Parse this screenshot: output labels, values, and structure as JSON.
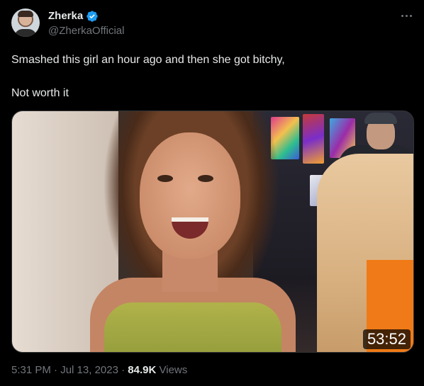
{
  "author": {
    "display_name": "Zherka",
    "handle": "@ZherkaOfficial",
    "verified_color": "#1d9bf0"
  },
  "icons": {
    "verified": "verified-badge-icon",
    "more": "more-options-icon"
  },
  "tweet": {
    "line1": "Smashed this girl an hour ago and then she got bitchy,",
    "line2": "Not worth it"
  },
  "media": {
    "type": "video",
    "duration": "53:52"
  },
  "meta": {
    "time": "5:31 PM",
    "separator": "·",
    "date": "Jul 13, 2023",
    "views_count": "84.9K",
    "views_label": "Views"
  },
  "colors": {
    "background": "#000000",
    "text_primary": "#e7e9ea",
    "text_secondary": "#71767b",
    "border": "#2f3336"
  }
}
